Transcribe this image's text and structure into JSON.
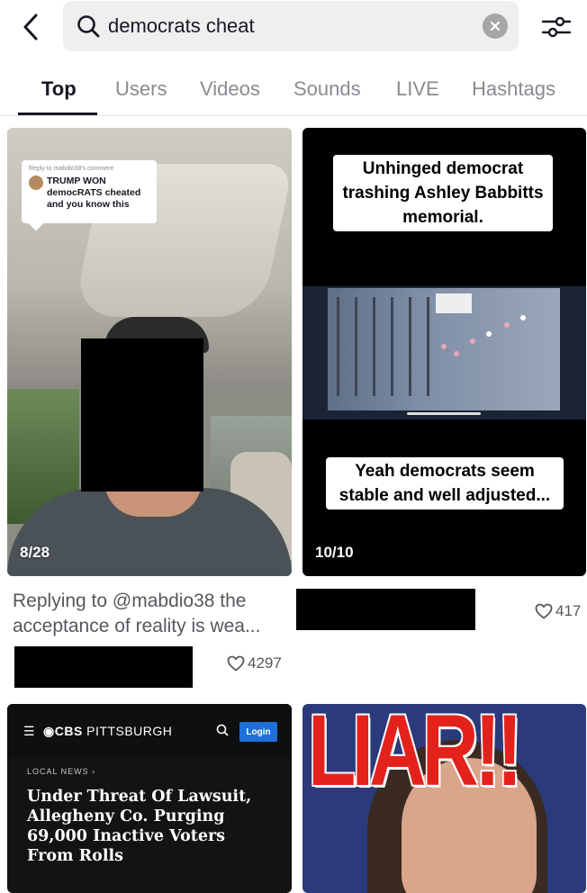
{
  "search": {
    "query": "democrats cheat"
  },
  "tabs": [
    {
      "label": "Top",
      "active": true
    },
    {
      "label": "Users"
    },
    {
      "label": "Videos"
    },
    {
      "label": "Sounds"
    },
    {
      "label": "LIVE"
    },
    {
      "label": "Hashtags"
    }
  ],
  "results": [
    {
      "overlay_reply": "Reply to mabdio38's comment",
      "overlay_comment": "TRUMP WON democRATS cheated and you know this",
      "counter": "8/28",
      "description": "Replying to @mabdio38 the acceptance of reality is wea...",
      "likes": "4297"
    },
    {
      "caption_top": "Unhinged democrat trashing Ashley Babbitts memorial.",
      "caption_bottom": "Yeah democrats seem stable and well adjusted...",
      "counter": "10/10",
      "likes": "417"
    },
    {
      "brand": "CBS",
      "brand_city": "PITTSBURGH",
      "login": "Login",
      "kicker": "LOCAL NEWS ›",
      "headline": "Under Threat Of Lawsuit, Allegheny Co. Purging 69,000 Inactive Voters From Rolls"
    },
    {
      "title": "LIAR!!"
    }
  ],
  "colors": {
    "text": "#161823",
    "muted": "#8a8b91",
    "cbs_blue": "#1e6fd9",
    "liar_red": "#e4221c"
  }
}
